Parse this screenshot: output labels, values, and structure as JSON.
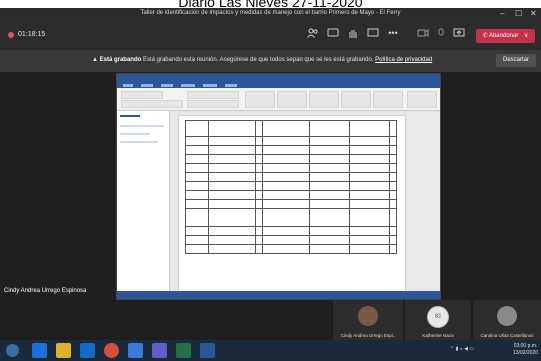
{
  "caption": "Diario Las Nieves 27-11-2020",
  "window": {
    "title": "Taller de identificación de impactos y medidas de manejo con el barrio Primero de Mayo - El Ferry",
    "min": "–",
    "max": "☐",
    "close": "✕"
  },
  "call": {
    "timer": "01:18:15",
    "icons": [
      "people-icon",
      "chat-icon",
      "raise-hand-icon",
      "share-icon",
      "more-icon",
      "video-icon",
      "mic-icon",
      "share-screen-icon"
    ],
    "hangup_label": "Abandonar",
    "hangup_arrow": "∨"
  },
  "banner": {
    "bold": "Está grabando",
    "text": " Está grabando esta reunión. Asegúrese de que todos sepan que se les está grabando.",
    "link": "Política de privacidad",
    "dismiss_label": "Descartar"
  },
  "presenter_name": "Cindy Andrea Urrego Espinosa",
  "participants": [
    {
      "name": "Cindy Andrea Urrego Espi..",
      "initials": "",
      "bg": "#7a5a44"
    },
    {
      "name": "Katherine Isaza",
      "initials": "KI",
      "bg": "#e7e7e7"
    },
    {
      "name": "Carolina Ulloa Castellanos",
      "initials": "",
      "bg": "#8a8a8a"
    }
  ],
  "taskbar": {
    "apps": [
      {
        "name": "ie",
        "color": "#1e6fd9"
      },
      {
        "name": "explorer",
        "color": "#e0b030"
      },
      {
        "name": "outlook",
        "color": "#1769c7"
      },
      {
        "name": "chrome",
        "color": "#d64f3a"
      },
      {
        "name": "media",
        "color": "#3a7bd5"
      },
      {
        "name": "teams",
        "color": "#5b5fc7"
      },
      {
        "name": "excel",
        "color": "#217346"
      },
      {
        "name": "word",
        "color": "#2b579a"
      }
    ],
    "time": "03:00 p.m.",
    "date": "13/02/2020"
  },
  "accent": "#c4314b",
  "word_brand": "#2b579a"
}
